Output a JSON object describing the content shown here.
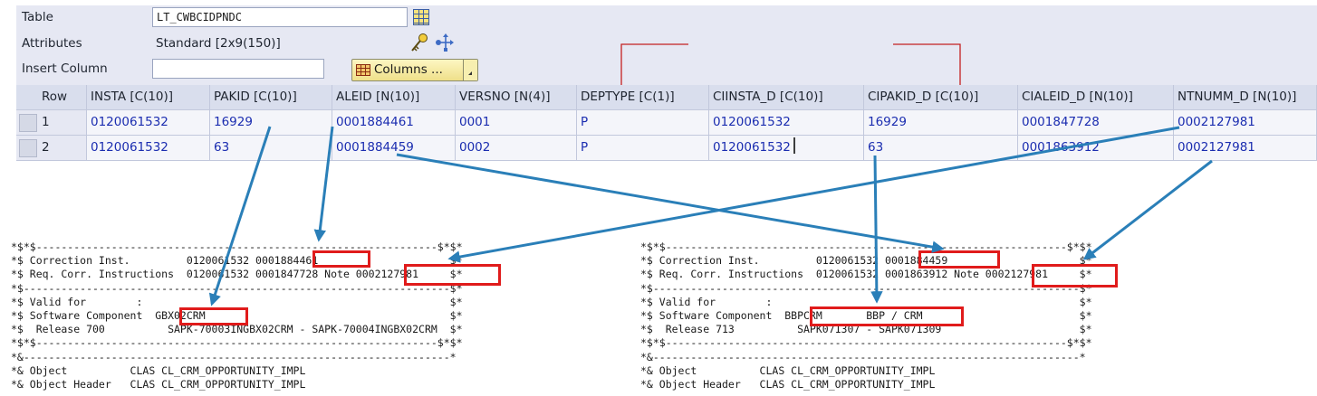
{
  "form": {
    "table_label": "Table",
    "table_value": "LT_CWBCIDPNDC",
    "attributes_label": "Attributes",
    "attributes_value": "Standard [2x9(150)]",
    "insert_column_label": "Insert Column",
    "insert_column_value": "",
    "columns_button": "Columns ..."
  },
  "grid": {
    "headers": [
      "Row",
      "INSTA [C(10)]",
      "PAKID [C(10)]",
      "ALEID [N(10)]",
      "VERSNO [N(4)]",
      "DEPTYPE [C(1)]",
      "CIINSTA_D [C(10)]",
      "CIPAKID_D [C(10)]",
      "CIALEID_D [N(10)]",
      "NTNUMM_D [N(10)]"
    ],
    "rows": [
      [
        "1",
        "0120061532",
        "16929",
        "0001884461",
        "0001",
        "P",
        "0120061532",
        "16929",
        "0001847728",
        "0002127981"
      ],
      [
        "2",
        "0120061532",
        "63",
        "0001884459",
        "0002",
        "P",
        "0120061532",
        "63",
        "0001863912",
        "0002127981"
      ]
    ]
  },
  "code_left": [
    "*$*$----------------------------------------------------------------$*$*",
    "*$ Correction Inst.         0120061532 0001884461                     $*",
    "*$ Req. Corr. Instructions  0120061532 0001847728 Note 0002127981     $*",
    "*$--------------------------------------------------------------------$*",
    "*$ Valid for        :                                                 $*",
    "*$ Software Component  GBX02CRM                                       $*",
    "*$  Release 700          SAPK-70003INGBX02CRM - SAPK-70004INGBX02CRM  $*",
    "*$*$----------------------------------------------------------------$*$*",
    "*&--------------------------------------------------------------------*",
    "*& Object          CLAS CL_CRM_OPPORTUNITY_IMPL",
    "*& Object Header   CLAS CL_CRM_OPPORTUNITY_IMPL"
  ],
  "code_right": [
    "*$*$----------------------------------------------------------------$*$*",
    "*$ Correction Inst.         0120061532 0001884459                     $*",
    "*$ Req. Corr. Instructions  0120061532 0001863912 Note 0002127981     $*",
    "*$--------------------------------------------------------------------$*",
    "*$ Valid for        :                                                 $*",
    "*$ Software Component  BBPCRM       BBP / CRM                         $*",
    "*$  Release 713          SAPK071307 - SAPK071309                      $*",
    "*$*$----------------------------------------------------------------$*$*",
    "*&--------------------------------------------------------------------*",
    "*& Object          CLAS CL_CRM_OPPORTUNITY_IMPL",
    "*& Object Header   CLAS CL_CRM_OPPORTUNITY_IMPL"
  ],
  "colors": {
    "arrow": "#2a7fb8",
    "highlight": "#e01b1b",
    "connector": "#c42020",
    "cell_text": "#1b2db0"
  }
}
